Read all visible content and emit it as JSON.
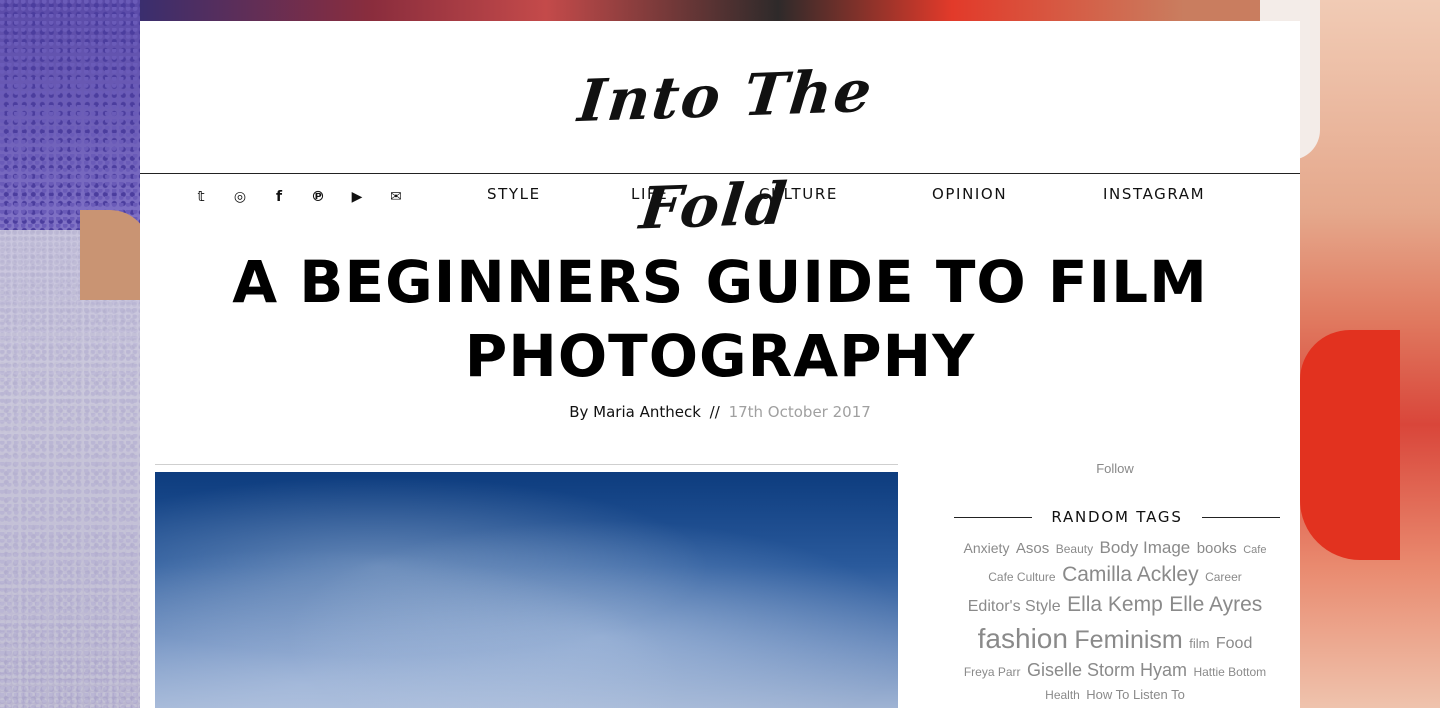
{
  "site": {
    "logo_text": "Into The Fold"
  },
  "social": [
    {
      "icon": "twitter-icon",
      "glyph": "𝕥"
    },
    {
      "icon": "instagram-icon",
      "glyph": "◎"
    },
    {
      "icon": "facebook-icon",
      "glyph": "f"
    },
    {
      "icon": "pinterest-icon",
      "glyph": "℗"
    },
    {
      "icon": "youtube-icon",
      "glyph": "▶"
    },
    {
      "icon": "email-icon",
      "glyph": "✉"
    }
  ],
  "nav": {
    "items": [
      "STYLE",
      "LIFE",
      "CULTURE",
      "OPINION",
      "INSTAGRAM"
    ]
  },
  "article": {
    "title": "A BEGINNERS GUIDE TO FILM PHOTOGRAPHY",
    "by": "By Maria Antheck",
    "separator": "//",
    "date": "17th October 2017"
  },
  "sidebar": {
    "follow_label": "Follow",
    "tags_heading": "RANDOM TAGS",
    "tags": [
      {
        "label": "Anxiety",
        "size": 14
      },
      {
        "label": "Asos",
        "size": 15
      },
      {
        "label": "Beauty",
        "size": 12
      },
      {
        "label": "Body Image",
        "size": 17
      },
      {
        "label": "books",
        "size": 15
      },
      {
        "label": "Cafe",
        "size": 11
      },
      {
        "label": "Cafe Culture",
        "size": 12
      },
      {
        "label": "Camilla Ackley",
        "size": 21
      },
      {
        "label": "Career",
        "size": 12
      },
      {
        "label": "Editor's Style",
        "size": 16
      },
      {
        "label": "Ella Kemp",
        "size": 21
      },
      {
        "label": "Elle Ayres",
        "size": 21
      },
      {
        "label": "fashion",
        "size": 28
      },
      {
        "label": "Feminism",
        "size": 25
      },
      {
        "label": "film",
        "size": 13
      },
      {
        "label": "Food",
        "size": 16
      },
      {
        "label": "Freya Parr",
        "size": 12
      },
      {
        "label": "Giselle Storm Hyam",
        "size": 18
      },
      {
        "label": "Hattie Bottom",
        "size": 12
      },
      {
        "label": "Health",
        "size": 12
      },
      {
        "label": "How To Listen To",
        "size": 13
      }
    ]
  }
}
